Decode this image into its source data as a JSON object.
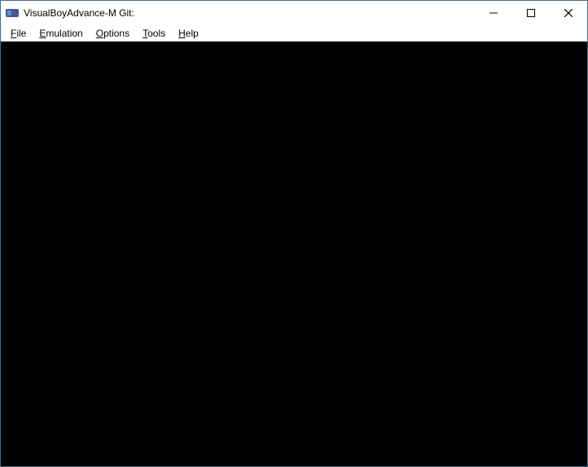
{
  "window": {
    "title": "VisualBoyAdvance-M Git:"
  },
  "menu": {
    "file": "File",
    "emulation": "Emulation",
    "options": "Options",
    "tools": "Tools",
    "help": "Help"
  }
}
